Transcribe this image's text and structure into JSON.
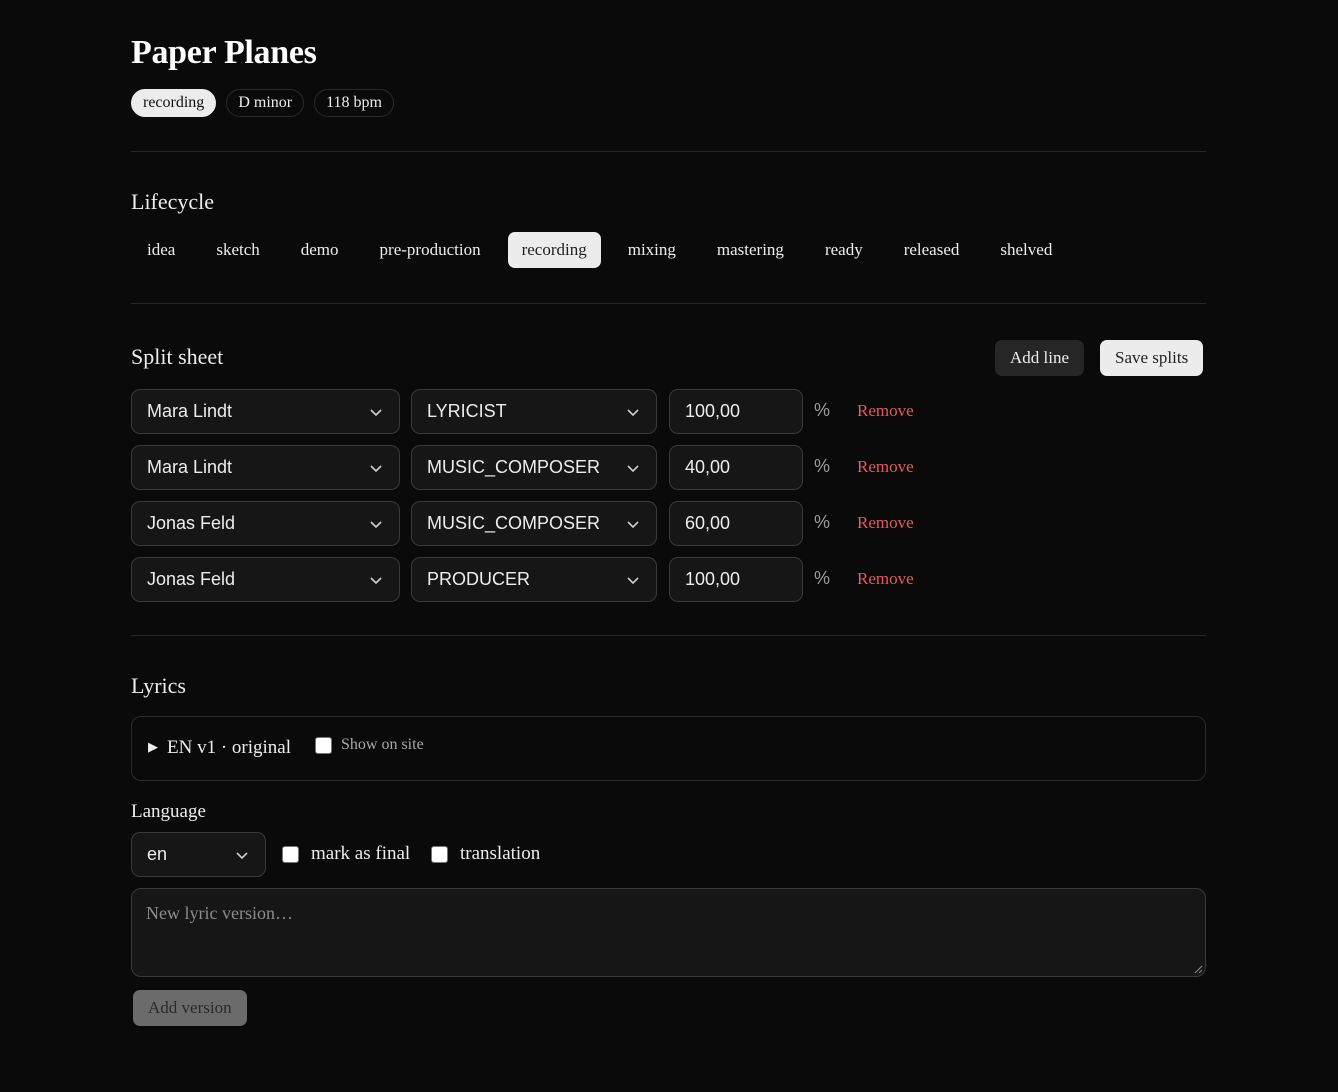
{
  "header": {
    "title": "Paper Planes",
    "badges": [
      "recording",
      "D minor",
      "118 bpm"
    ]
  },
  "lifecycle": {
    "title": "Lifecycle",
    "stages": [
      "idea",
      "sketch",
      "demo",
      "pre-production",
      "recording",
      "mixing",
      "mastering",
      "ready",
      "released",
      "shelved"
    ],
    "active_stage": "recording"
  },
  "splits": {
    "title": "Split sheet",
    "add_line_label": "Add line",
    "save_label": "Save splits",
    "percent_sign": "%",
    "remove_label": "Remove",
    "rows": [
      {
        "person": "Mara Lindt",
        "role": "LYRICIST",
        "percent": "100,00"
      },
      {
        "person": "Mara Lindt",
        "role": "MUSIC_COMPOSER",
        "percent": "40,00"
      },
      {
        "person": "Jonas Feld",
        "role": "MUSIC_COMPOSER",
        "percent": "60,00"
      },
      {
        "person": "Jonas Feld",
        "role": "PRODUCER",
        "percent": "100,00"
      }
    ]
  },
  "lyrics": {
    "title": "Lyrics",
    "version_summary": "EN v1 · original",
    "show_on_site_label": "Show on site",
    "show_on_site_checked": false,
    "language_label": "Language",
    "language_value": "en",
    "mark_final_label": "mark as final",
    "mark_final_checked": false,
    "translation_label": "translation",
    "translation_checked": false,
    "textarea_placeholder": "New lyric version…",
    "add_version_label": "Add version"
  },
  "colors": {
    "background": "#0a0a0a",
    "remove_link": "#e65a5a",
    "active_pill": "#ececec"
  }
}
